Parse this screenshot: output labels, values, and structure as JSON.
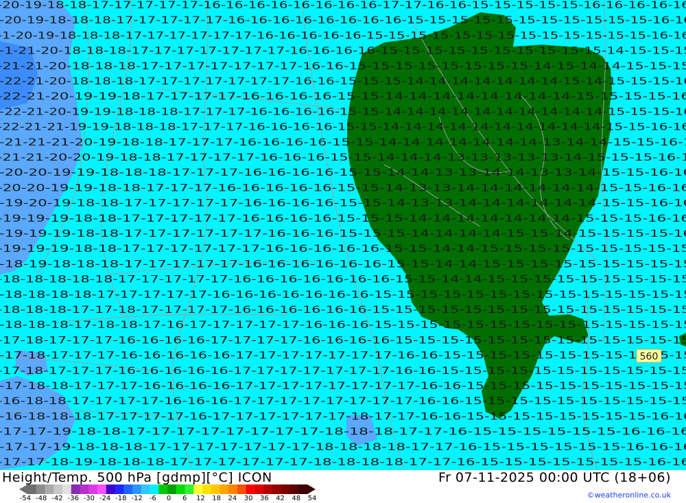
{
  "map": {
    "title_line": "Height/Temp. 500 hPa [gdmp][°C] ICON",
    "valid_time": "Fr 07-11-2025 00:00 UTC (18+06)",
    "credit": "©weatheronline.co.uk",
    "contour_label": "560",
    "colors": {
      "sea_cyan": "#00f5ff",
      "cold_blue": "#5aa8ff",
      "land_green": "#006e00",
      "isotherm": "#a0a0a0",
      "label_text": "#1a1a1a"
    },
    "temperature_labels": {
      "rows": [
        "-20-19-18-18-17-17-17-17-17-16-16-16-16-16-16-16-16-17-17-16-16-15-15-15-15-15-16-16-16-16-16",
        "-20-19-18-18-18-17-17-17-17-17-16-16-16-16-16-16-16-16-15-15-15-15-15-15-15-15-15-15-15-16-16",
        "-1-20-19-18-18-18-17-17-17-17-17-17-16-16-16-16-16-15-15-15-15-15-15-15-15-15-15-15-15-15-16-16",
        "-1-21-20-18-18-18-17-17-17-17-17-17-17-16-16-16-16-15-15-15-15-15-15-15-15-15-15-14-15-15-15",
        "-21-21-20-18-18-18-17-17-17-17-17-17-17-16-16-15-15-15-15-15-15-15-15-14-15-14-14-15-15-15",
        "-22-21-20-18-18-18-17-17-17-17-17-17-17-16-16-15-15-15-14-14-14-14-14-14-14-15-14-15-15-15-16",
        "-22-21-20-19-19-18-17-17-17-17-16-16-16-16-15-15-14-14-14-14-14-14-14-14-15-15-15-15-16",
        "-22-21-20-19-19-18-18-18-17-17-17-16-16-16-16-15-15-14-14-14-14-14-14-14-14-14-14-15-15-15-16",
        "-22-21-21-19-19-18-18-18-17-17-17-16-16-16-16-15-15-14-14-14-14-14-14-14-14-14-14-15-15-16-16",
        "-21-21-21-20-19-18-18-17-17-17-16-16-16-16-15-15-14-14-14-14-14-14-14-13-14-14-15-15-16-1",
        "-21-21-20-20-19-18-18-17-17-17-17-16-16-16-15-15-14-14-14-13-13-13-13-13-14-15-15-15-16-1",
        "-20-20-19-19-18-18-18-17-17-17-16-16-16-16-15-15-14-14-13-13-14-14-13-13-14-15-15-16-16",
        "-20-20-19-19-18-18-17-17-17-16-16-16-16-16-15-15-14-13-13-14-14-14-14-14-14-15-15-16-16",
        "-19-20-19-18-18-17-17-17-17-17-16-16-16-16-15-15-14-13-13-14-14-14-14-14-14-15-15-16-16",
        "-19-19-19-18-18-17-17-17-17-17-16-16-16-16-15-15-15-14-14-14-14-14-14-14-15-15-15-16-16",
        "-19-19-19-18-18-17-17-17-17-17-17-16-16-16-15-15-15-14-14-14-14-15-15-14-15-15-15-15-16",
        "-19-19-19-18-18-17-17-17-17-17-17-16-16-16-16-16-15-15-14-14-15-15-15-15-15-15-15-15-15",
        "-18-19-18-18-18-17-17-17-17-17-16-16-16-16-16-16-15-15-14-14-15-15-15-15-15-15-15-15-15",
        "-18-18-18-18-18-17-17-17-17-17-16-16-16-16-16-16-16-15-15-14-14-15-15-15-15-15-15-15-15-15",
        "-18-18-18-18-17-17-17-17-17-16-16-16-16-16-16-16-15-15-15-15-15-15-15-15-15-15-15-15-15-15",
        "-18-18-18-17-17-18-17-17-17-17-16-16-16-16-16-16-15-15-15-15-15-15-15-15-15-15-15-15-15-15",
        "-18-18-18-17-18-18-17-16-17-17-17-17-17-16-16-16-15-15-15-15-15-15-15-15-15-15-15-15-15-15",
        "-17-18-17-17-17-16-16-16-16-17-17-17-17-16-16-16-16-15-15-15-15-15-15-15-15-15-15-15-15-15",
        "-17-18-17-17-17-16-16-16-16-16-17-17-17-17-17-17-17-16-16-15-15-15-15-15-15-15-15-15-15-15",
        "-17-18-17-17-17-16-16-16-16-16-17-17-17-17-17-17-17-16-16-15-15-15-15-15-15-15-15-15-15-15",
        "-17-18-18-17-17-17-16-16-16-16-17-17-17-17-17-17-17-17-16-16-15-15-15-15-15-15-15-15-15-15",
        "-16-18-18-17-17-17-17-16-16-16-17-17-17-17-17-17-17-17-16-16-15-15-15-15-15-15-15-15-15-15",
        "-16-18-18-18-17-17-17-17-16-17-17-17-17-17-17-18-17-17-16-16-15-15-15-15-15-15-15-15-16-16",
        "-17-17-19-18-18-17-17-17-17-17-17-17-17-18-18-18-17-17-16-15-15-15-15-15-15-16-16-16",
        "-17-17-19-18-18-18-17-17-17-17-17-17-17-18-18-18-18-17-17-16-15-15-15-15-15-15-16-16-16",
        "-17-17-18-19-18-18-18-17-17-17-17-17-17-18-18-18-18-17-17-16-15-15-15-15-15-15-15-16-16"
      ]
    }
  },
  "legend": {
    "ticks": [
      "-54",
      "-48",
      "-42",
      "-36",
      "-30",
      "-24",
      "-18",
      "-12",
      "-6",
      "0",
      "6",
      "12",
      "18",
      "24",
      "30",
      "36",
      "42",
      "48",
      "54"
    ],
    "colors": [
      "#6e6e6e",
      "#8c8c8c",
      "#aaaaaa",
      "#c8c8c8",
      "#e0e0e0",
      "#8a2ab4",
      "#b432c8",
      "#dc3ce6",
      "#ff50ff",
      "#3c00c8",
      "#1e28ff",
      "#1e64ff",
      "#2896ff",
      "#32c8ff",
      "#00f0ff",
      "#00c800",
      "#00a000",
      "#00dc00",
      "#32f032",
      "#ffff32",
      "#ffe100",
      "#ffc800",
      "#ffa500",
      "#ff8200",
      "#ff5000",
      "#ff0000",
      "#dc0000",
      "#b40000",
      "#960000",
      "#780000",
      "#5a0000",
      "#3c0000"
    ]
  }
}
